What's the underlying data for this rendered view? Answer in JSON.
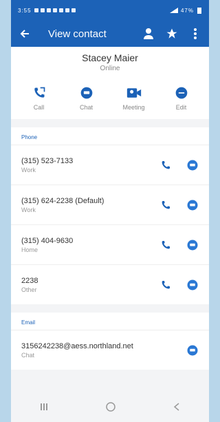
{
  "status_bar": {
    "left_text": "3:55",
    "right_text": "47%"
  },
  "app_bar": {
    "title": "View contact"
  },
  "contact": {
    "name": "Stacey Maier",
    "status": "Online"
  },
  "actions": [
    {
      "label": "Call",
      "icon": "call-icon"
    },
    {
      "label": "Chat",
      "icon": "chat-icon"
    },
    {
      "label": "Meeting",
      "icon": "video-icon"
    },
    {
      "label": "Edit",
      "icon": "edit-icon"
    }
  ],
  "phone_section": {
    "title": "Phone",
    "rows": [
      {
        "number": "(315) 523-7133",
        "type": "Work"
      },
      {
        "number": "(315) 624-2238 (Default)",
        "type": "Work"
      },
      {
        "number": "(315) 404-9630",
        "type": "Home"
      },
      {
        "number": "2238",
        "type": "Other"
      }
    ]
  },
  "email_section": {
    "title": "Email",
    "rows": [
      {
        "address": "3156242238@aess.northland.net",
        "type": "Chat"
      }
    ]
  },
  "colors": {
    "primary": "#1c62b7",
    "accent": "#2a78d4"
  }
}
